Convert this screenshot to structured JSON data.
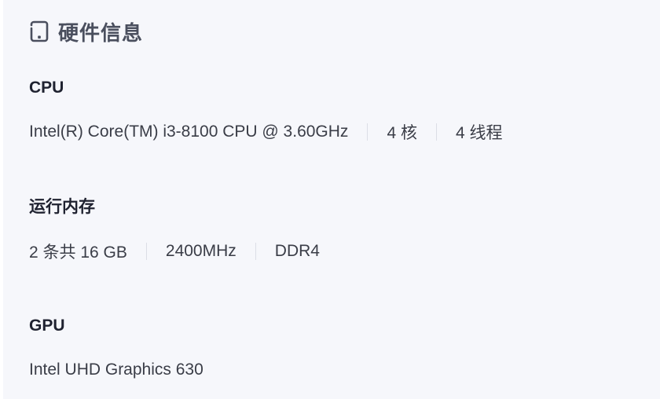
{
  "header": {
    "icon": "tablet-icon",
    "title": "硬件信息"
  },
  "cpu": {
    "label": "CPU",
    "model": "Intel(R) Core(TM) i3-8100 CPU @ 3.60GHz",
    "cores": "4 核",
    "threads": "4 线程"
  },
  "memory": {
    "label": "运行内存",
    "modules": "2 条共 16 GB",
    "speed": "2400MHz",
    "type": "DDR4"
  },
  "gpu": {
    "label": "GPU",
    "model": "Intel UHD Graphics 630"
  },
  "colors": {
    "panel_bg": "#f6f7fb",
    "title": "#4a4f5e",
    "label": "#1f2230",
    "value": "#3a3d47",
    "separator": "#dcdee6"
  }
}
